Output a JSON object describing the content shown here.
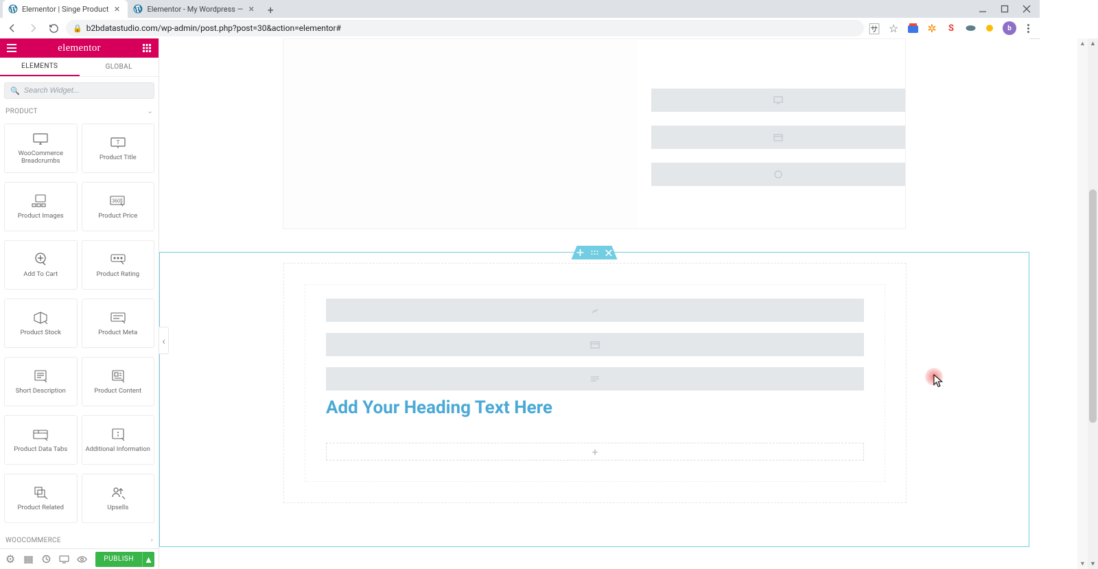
{
  "browser": {
    "tabs": [
      {
        "title": "Elementor | Singe Product",
        "active": true
      },
      {
        "title": "Elementor - My Wordpress —",
        "active": false
      }
    ],
    "url": "b2bdatastudio.com/wp-admin/post.php?post=30&action=elementor#",
    "avatar_initial": "b"
  },
  "panel": {
    "logo": "elementor",
    "tabs": {
      "elements": "ELEMENTS",
      "global": "GLOBAL"
    },
    "search_placeholder": "Search Widget...",
    "groups": {
      "product": "PRODUCT",
      "woocommerce": "WOOCOMMERCE"
    },
    "widgets": [
      {
        "id": "woocommerce-breadcrumbs",
        "label": "WooCommerce Breadcrumbs"
      },
      {
        "id": "product-title",
        "label": "Product Title"
      },
      {
        "id": "product-images",
        "label": "Product Images"
      },
      {
        "id": "product-price",
        "label": "Product Price"
      },
      {
        "id": "add-to-cart",
        "label": "Add To Cart"
      },
      {
        "id": "product-rating",
        "label": "Product Rating"
      },
      {
        "id": "product-stock",
        "label": "Product Stock"
      },
      {
        "id": "product-meta",
        "label": "Product Meta"
      },
      {
        "id": "short-description",
        "label": "Short Description"
      },
      {
        "id": "product-content",
        "label": "Product Content"
      },
      {
        "id": "product-data-tabs",
        "label": "Product Data Tabs"
      },
      {
        "id": "additional-information",
        "label": "Additional Information"
      },
      {
        "id": "product-related",
        "label": "Product Related"
      },
      {
        "id": "upsells",
        "label": "Upsells"
      }
    ],
    "publish": "PUBLISH"
  },
  "canvas": {
    "heading_placeholder": "Add Your Heading Text Here"
  }
}
